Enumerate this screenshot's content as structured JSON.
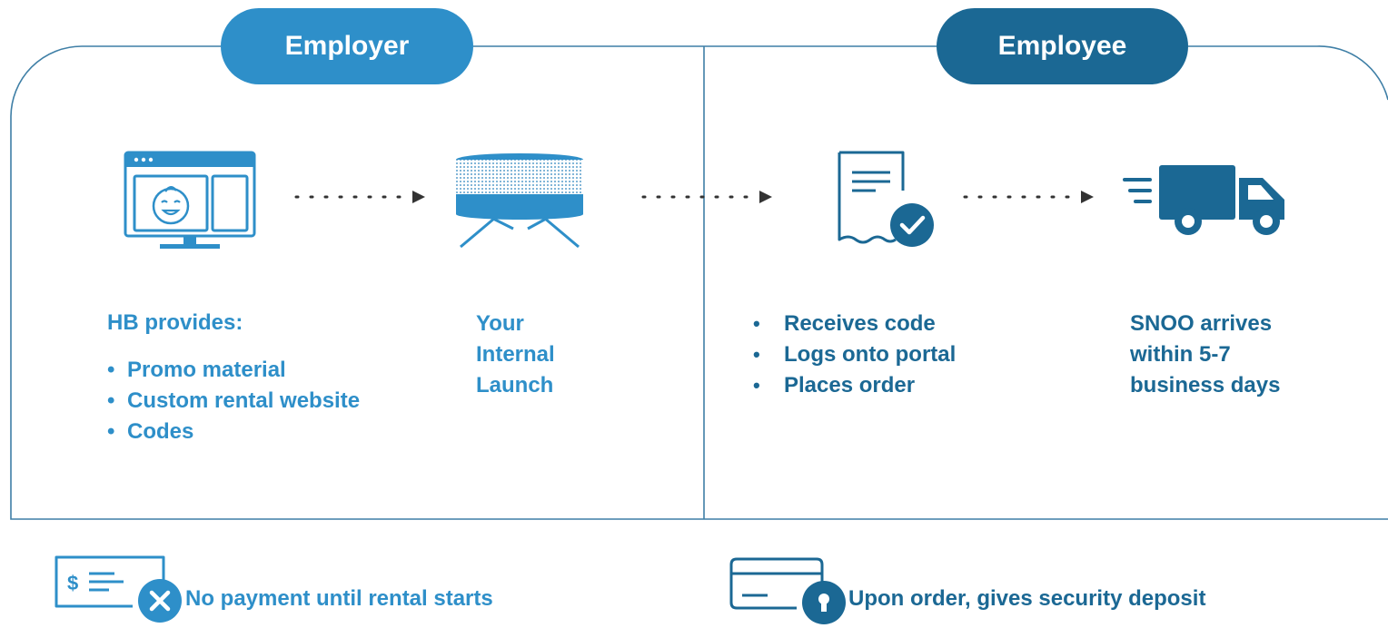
{
  "employer": {
    "header": "Employer",
    "step1": {
      "title": "HB provides:",
      "items": [
        "Promo material",
        "Custom rental website",
        "Codes"
      ]
    },
    "step2": {
      "lines": [
        "Your",
        "Internal",
        "Launch"
      ]
    }
  },
  "employee": {
    "header": "Employee",
    "step3": {
      "items": [
        "Receives code",
        "Logs onto portal",
        "Places order"
      ]
    },
    "step4": {
      "lines": [
        "SNOO arrives",
        "within 5-7",
        "business days"
      ]
    }
  },
  "footer": {
    "payment_note": "No payment until rental starts",
    "deposit_note": "Upon order, gives security deposit"
  },
  "colors": {
    "light_blue": "#2e8fc9",
    "dark_blue": "#1b6894",
    "line": "#3f7fa6"
  },
  "icons": [
    "browser-baby-icon",
    "bassinet-icon",
    "receipt-check-icon",
    "delivery-truck-icon",
    "payment-check-icon",
    "credit-card-lock-icon"
  ]
}
